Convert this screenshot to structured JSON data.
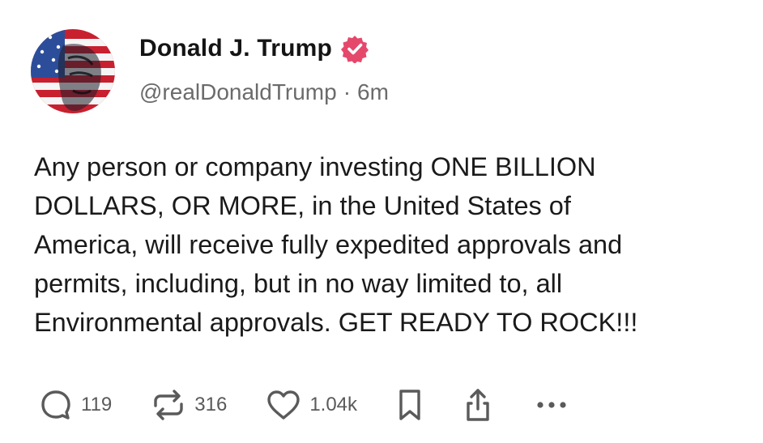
{
  "post": {
    "author": {
      "display_name": "Donald J. Trump",
      "handle": "@realDonaldTrump",
      "separator": "·",
      "time_ago": "6m",
      "verified": true,
      "verified_color": "#e5486b",
      "avatar_icon": "flag-portrait-avatar"
    },
    "body": "Any person or company investing ONE BILLION\nDOLLARS, OR MORE, in the United States of\nAmerica, will receive fully expedited approvals and\npermits, including, but in no way limited to, all\nEnvironmental approvals. GET READY TO ROCK!!!",
    "actions": {
      "reply": {
        "icon": "reply-icon",
        "count": "119"
      },
      "repost": {
        "icon": "repost-icon",
        "count": "316"
      },
      "like": {
        "icon": "heart-icon",
        "count": "1.04k"
      },
      "bookmark": {
        "icon": "bookmark-icon"
      },
      "share": {
        "icon": "share-icon"
      },
      "more": {
        "icon": "more-icon"
      }
    },
    "colors": {
      "text": "#1a1a1a",
      "muted": "#6b6b6b",
      "icon": "#5a5a5a"
    }
  }
}
